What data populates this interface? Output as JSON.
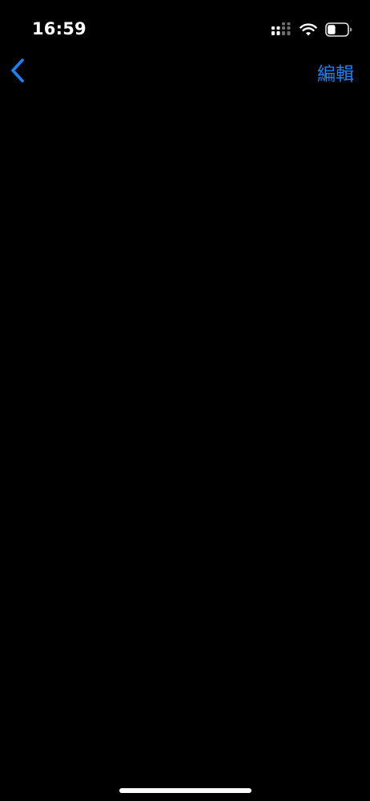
{
  "status_bar": {
    "time": "16:59",
    "icons": [
      "signal-icon",
      "wifi-icon",
      "battery-icon"
    ],
    "battery_level": 0.4
  },
  "nav_bar": {
    "back_icon": "chevron-left-icon",
    "edit_label": "編輯"
  },
  "colors": {
    "background": "#000000",
    "accent": "#1a82f4",
    "text": "#ffffff"
  }
}
